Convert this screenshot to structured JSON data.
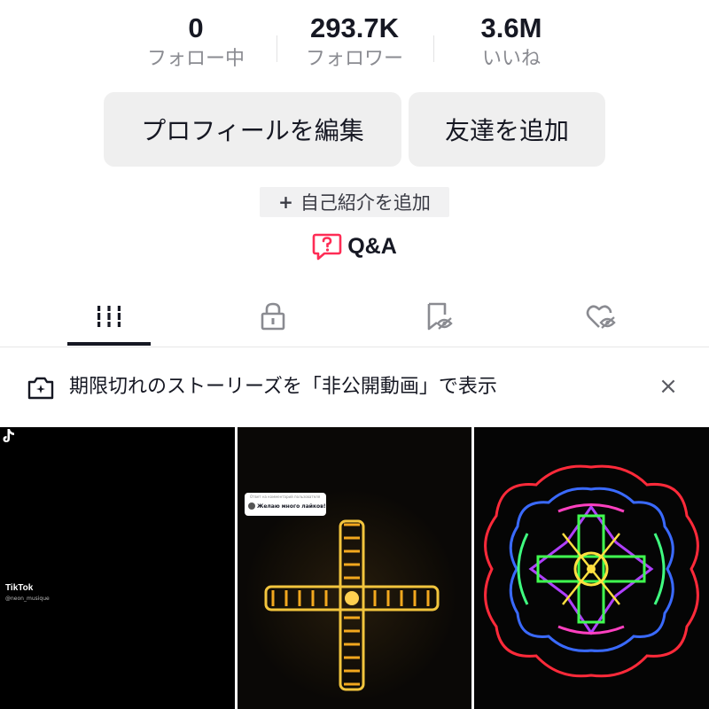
{
  "stats": {
    "following": {
      "value": "0",
      "label": "フォロー中"
    },
    "followers": {
      "value": "293.7K",
      "label": "フォロワー"
    },
    "likes": {
      "value": "3.6M",
      "label": "いいね"
    }
  },
  "buttons": {
    "edit_profile": "プロフィールを編集",
    "add_friend": "友達を追加"
  },
  "bio": {
    "plus": "+",
    "add_label": "自己紹介を追加"
  },
  "qa": {
    "label": "Q&A",
    "icon": "question-bubble-icon",
    "color": "#fe2c55"
  },
  "tabs": [
    {
      "name": "videos",
      "icon": "grid-bars-icon",
      "active": true
    },
    {
      "name": "private",
      "icon": "lock-icon",
      "active": false
    },
    {
      "name": "favorites",
      "icon": "bookmark-hidden-icon",
      "active": false
    },
    {
      "name": "liked",
      "icon": "heart-hidden-icon",
      "active": false
    }
  ],
  "banner": {
    "text": "期限切れのストーリーズを「非公開動画」で表示",
    "close": "×",
    "icon": "camera-sparkle-icon"
  },
  "videos": [
    {
      "watermark_brand": "TikTok",
      "watermark_user": "@neon_musique"
    },
    {
      "comment_reply": "Ответ на комментарий пользователя",
      "comment_text": "Желаю много лайков!"
    },
    {
      "description": "neon mandala"
    }
  ],
  "colors": {
    "text_primary": "#161823",
    "text_secondary": "#8a8b91",
    "button_bg": "#efefef",
    "accent": "#fe2c55"
  }
}
